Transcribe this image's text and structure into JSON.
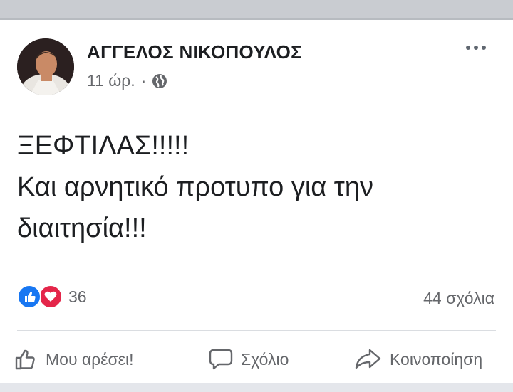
{
  "post": {
    "author": "ΑΓΓΕΛΟΣ ΝΙΚΟΠΟΥΛΟΣ",
    "timestamp": "11 ώρ.",
    "separator": "·",
    "audience_icon": "globe-icon",
    "more_icon": "more-options-icon",
    "text_lines": [
      "ΞΕΦΤΙΛΑΣ!!!!!",
      "Και αρνητικό προτυπο για την",
      "διαιτησία!!!"
    ]
  },
  "stats": {
    "reaction_icons": [
      "like-reaction-icon",
      "love-reaction-icon"
    ],
    "reaction_count": "36",
    "comments_count": "44 σχόλια"
  },
  "actions": {
    "like_label": "Μου αρέσει!",
    "comment_label": "Σχόλιο",
    "share_label": "Κοινοποίηση"
  },
  "colors": {
    "like_blue": "#1877f2",
    "love_red": "#e4264a",
    "secondary_text": "#65676b"
  }
}
